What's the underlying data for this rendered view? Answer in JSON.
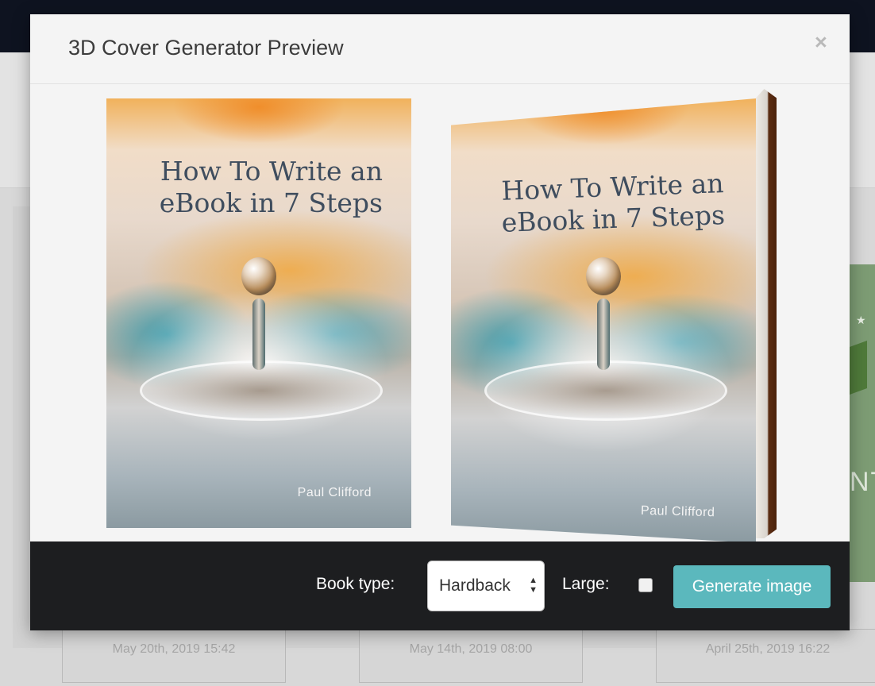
{
  "modal": {
    "title": "3D Cover Generator Preview",
    "close_label": "×"
  },
  "book": {
    "title_line1": "How To Write an",
    "title_line2": "eBook in 7 Steps",
    "author": "Paul Clifford"
  },
  "footer": {
    "book_type_label": "Book type:",
    "book_type_value": "Hardback",
    "large_label": "Large:",
    "large_checked": false,
    "generate_label": "Generate image"
  },
  "background": {
    "dates": [
      "May 20th, 2019 15:42",
      "May 14th, 2019 08:00",
      "April 25th, 2019 16:22"
    ],
    "side_banner_text": "NT"
  },
  "colors": {
    "footer_bg": "#1d1e20",
    "button_bg": "#5bb8bd",
    "top_bar": "#0e1320"
  }
}
